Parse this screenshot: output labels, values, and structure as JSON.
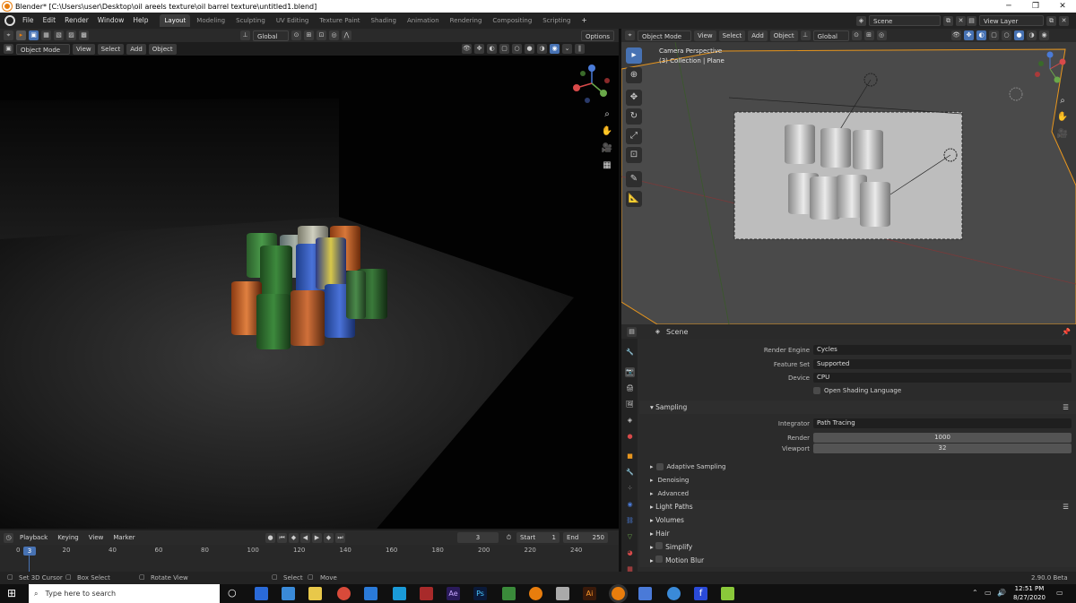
{
  "window": {
    "title": "Blender* [C:\\Users\\user\\Desktop\\oil areels texture\\oil barrel texture\\untitled1.blend]"
  },
  "menu": {
    "items": [
      "File",
      "Edit",
      "Render",
      "Window",
      "Help"
    ]
  },
  "workspaces": [
    "Layout",
    "Modeling",
    "Sculpting",
    "UV Editing",
    "Texture Paint",
    "Shading",
    "Animation",
    "Rendering",
    "Compositing",
    "Scripting"
  ],
  "scene": {
    "label": "Scene",
    "view_layer": "View Layer"
  },
  "left_view": {
    "transform": "Global",
    "options": "Options",
    "mode": "Object Mode",
    "menus": [
      "View",
      "Select",
      "Add",
      "Object"
    ]
  },
  "right_view": {
    "mode": "Object Mode",
    "menus": [
      "View",
      "Select",
      "Add",
      "Object"
    ],
    "transform": "Global",
    "info_line1": "Camera Perspective",
    "info_line2": "(3) Collection | Plane"
  },
  "properties": {
    "header": "Scene",
    "render_engine_label": "Render Engine",
    "render_engine": "Cycles",
    "feature_set_label": "Feature Set",
    "feature_set": "Supported",
    "device_label": "Device",
    "device": "CPU",
    "osl": "Open Shading Language",
    "sampling": "Sampling",
    "integrator_label": "Integrator",
    "integrator": "Path Tracing",
    "render_label": "Render",
    "render_samples": "1000",
    "viewport_label": "Viewport",
    "viewport_samples": "32",
    "adaptive": "Adaptive Sampling",
    "denoising": "Denoising",
    "advanced": "Advanced",
    "light_paths": "Light Paths",
    "volumes": "Volumes",
    "hair": "Hair",
    "simplify": "Simplify",
    "motion_blur": "Motion Blur"
  },
  "timeline": {
    "menus": [
      "Playback",
      "Keying",
      "View",
      "Marker"
    ],
    "current_frame": "3",
    "start_label": "Start",
    "start": "1",
    "end_label": "End",
    "end": "250",
    "ticks": [
      "0",
      "20",
      "40",
      "60",
      "80",
      "100",
      "120",
      "140",
      "160",
      "180",
      "200",
      "220",
      "240"
    ],
    "playhead": "3"
  },
  "status": {
    "set_cursor": "Set 3D Cursor",
    "box_select": "Box Select",
    "rotate_view": "Rotate View",
    "select": "Select",
    "move": "Move",
    "version": "2.90.0 Beta"
  },
  "taskbar": {
    "search_placeholder": "Type here to search",
    "time": "12:51 PM",
    "date": "8/27/2020"
  },
  "colors": {
    "accent": "#4772b3",
    "active_tab": "#3d3d3d",
    "orange": "#e87d0d"
  }
}
